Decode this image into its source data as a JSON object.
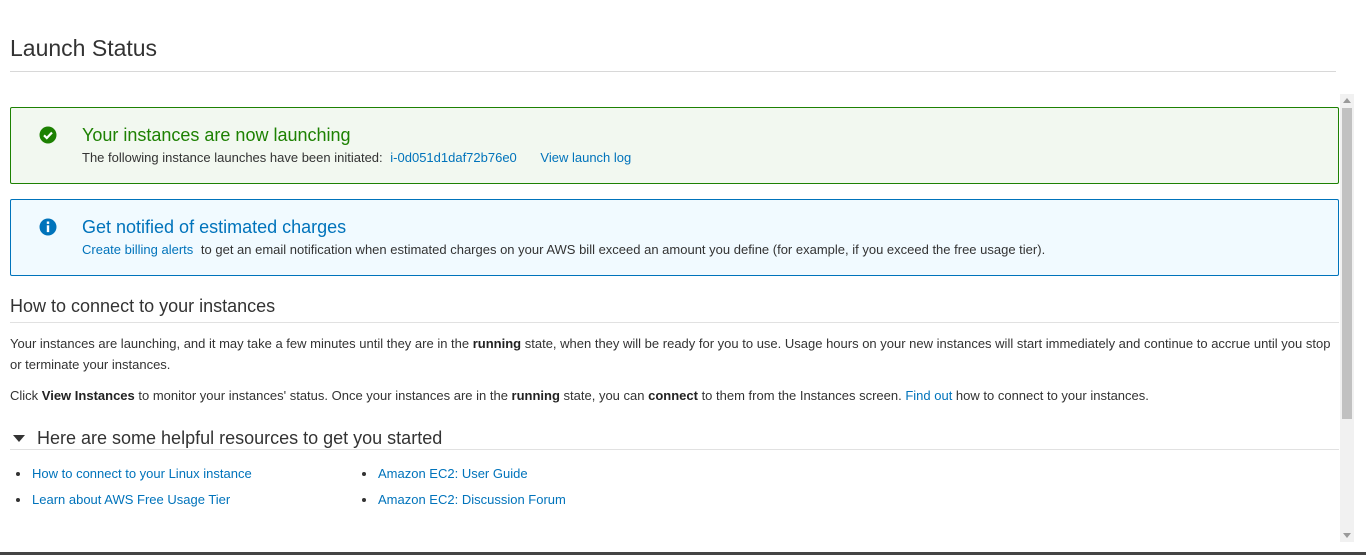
{
  "page": {
    "title": "Launch Status"
  },
  "success_alert": {
    "icon": "check-circle-icon",
    "title": "Your instances are now launching",
    "body_prefix": "The following instance launches have been initiated:",
    "instance_id": "i-0d051d1daf72b76e0",
    "log_link": "View launch log",
    "color": "#1d8102"
  },
  "info_alert": {
    "icon": "info-circle-icon",
    "title": "Get notified of estimated charges",
    "link": "Create billing alerts",
    "body_suffix": "to get an email notification when estimated charges on your AWS bill exceed an amount you define (for example, if you exceed the free usage tier).",
    "color": "#0073bb"
  },
  "connect": {
    "title": "How to connect to your instances",
    "p1_a": "Your instances are launching, and it may take a few minutes until they are in the ",
    "p1_bold": "running",
    "p1_b": " state, when they will be ready for you to use. Usage hours on your new instances will start immediately and continue to accrue until you stop or terminate your instances.",
    "p2_a": "Click ",
    "p2_bold1": "View Instances",
    "p2_b": " to monitor your instances' status. Once your instances are in the ",
    "p2_bold2": "running",
    "p2_c": " state, you can ",
    "p2_bold3": "connect",
    "p2_d": " to them from the Instances screen. ",
    "p2_link": "Find out",
    "p2_e": " how to connect to your instances."
  },
  "resources": {
    "title": "Here are some helpful resources to get you started",
    "col1": [
      "How to connect to your Linux instance",
      "Learn about AWS Free Usage Tier"
    ],
    "col2": [
      "Amazon EC2: User Guide",
      "Amazon EC2: Discussion Forum"
    ]
  }
}
